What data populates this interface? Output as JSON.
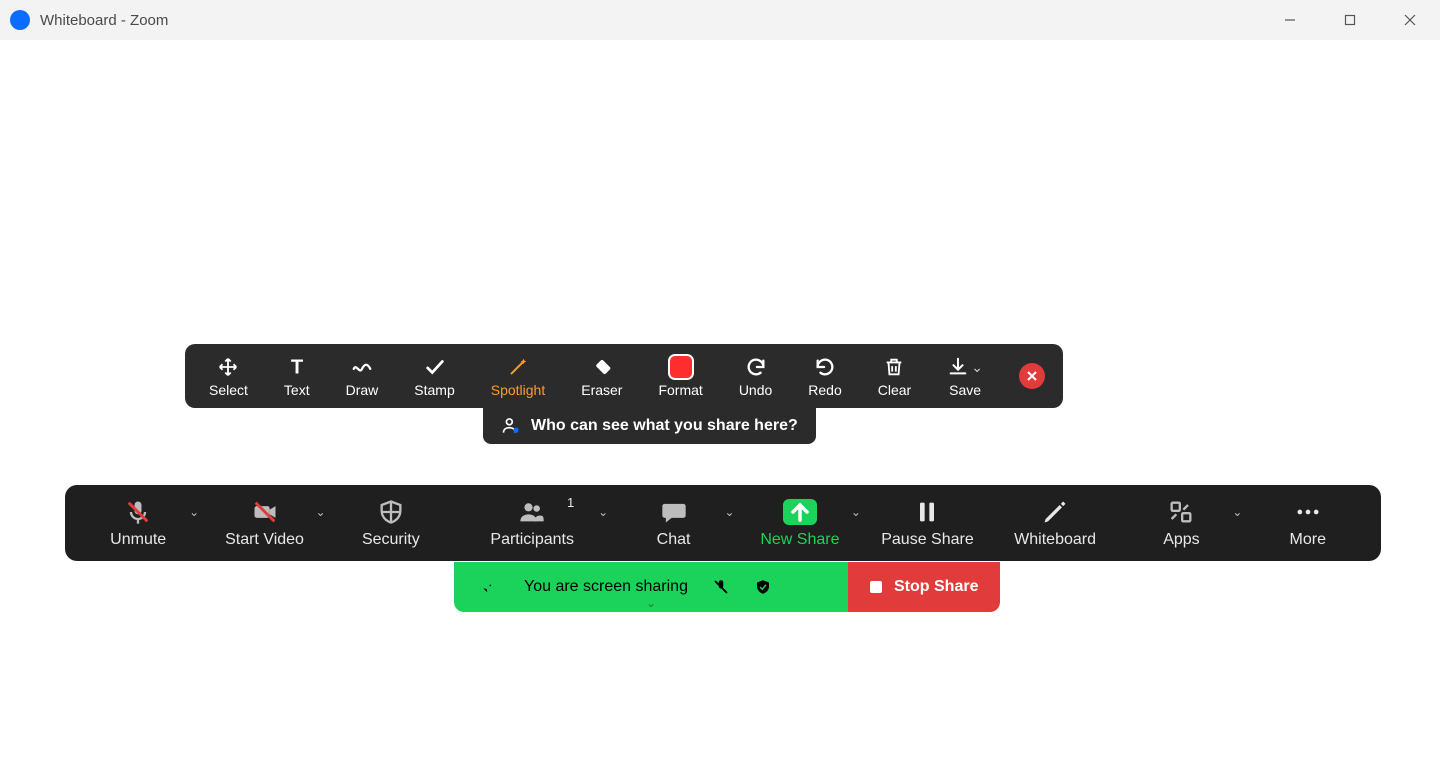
{
  "window": {
    "title": "Whiteboard - Zoom"
  },
  "annotation_toolbar": {
    "select": "Select",
    "text": "Text",
    "draw": "Draw",
    "stamp": "Stamp",
    "spotlight": "Spotlight",
    "eraser": "Eraser",
    "format": "Format",
    "undo": "Undo",
    "redo": "Redo",
    "clear": "Clear",
    "save": "Save",
    "format_color": "#ff2d2d",
    "active": "spotlight"
  },
  "share_tip": "Who can see what you share here?",
  "meeting_bar": {
    "unmute": "Unmute",
    "start_video": "Start Video",
    "security": "Security",
    "participants": "Participants",
    "participants_count": "1",
    "chat": "Chat",
    "new_share": "New Share",
    "pause_share": "Pause Share",
    "whiteboard": "Whiteboard",
    "apps": "Apps",
    "more": "More"
  },
  "share_banner": {
    "status": "You are screen sharing",
    "stop": "Stop Share"
  }
}
